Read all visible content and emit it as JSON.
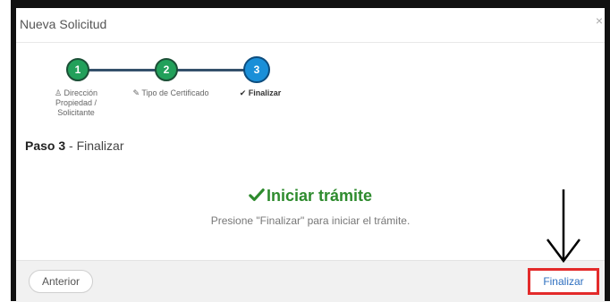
{
  "dialog": {
    "title": "Nueva Solicitud",
    "close_symbol": "×"
  },
  "wizard": {
    "steps": [
      {
        "number": "1",
        "label_line1": "Dirección",
        "label_line2": "Propiedad /",
        "label_line3": "Solicitante",
        "state": "done"
      },
      {
        "number": "2",
        "label_line1": "Tipo de Certificado",
        "state": "done"
      },
      {
        "number": "3",
        "label_line1": "Finalizar",
        "state": "active"
      }
    ]
  },
  "step_heading": {
    "bold": "Paso 3",
    "rest": " - Finalizar"
  },
  "success": {
    "title": "Iniciar trámite",
    "message": "Presione \"Finalizar\" para iniciar el trámite."
  },
  "footer": {
    "prev_label": "Anterior",
    "finish_label": "Finalizar"
  },
  "colors": {
    "done": "#22a05a",
    "active": "#1a8fd8",
    "success_text": "#2e8b2e",
    "highlight_border": "#e32b2b"
  }
}
